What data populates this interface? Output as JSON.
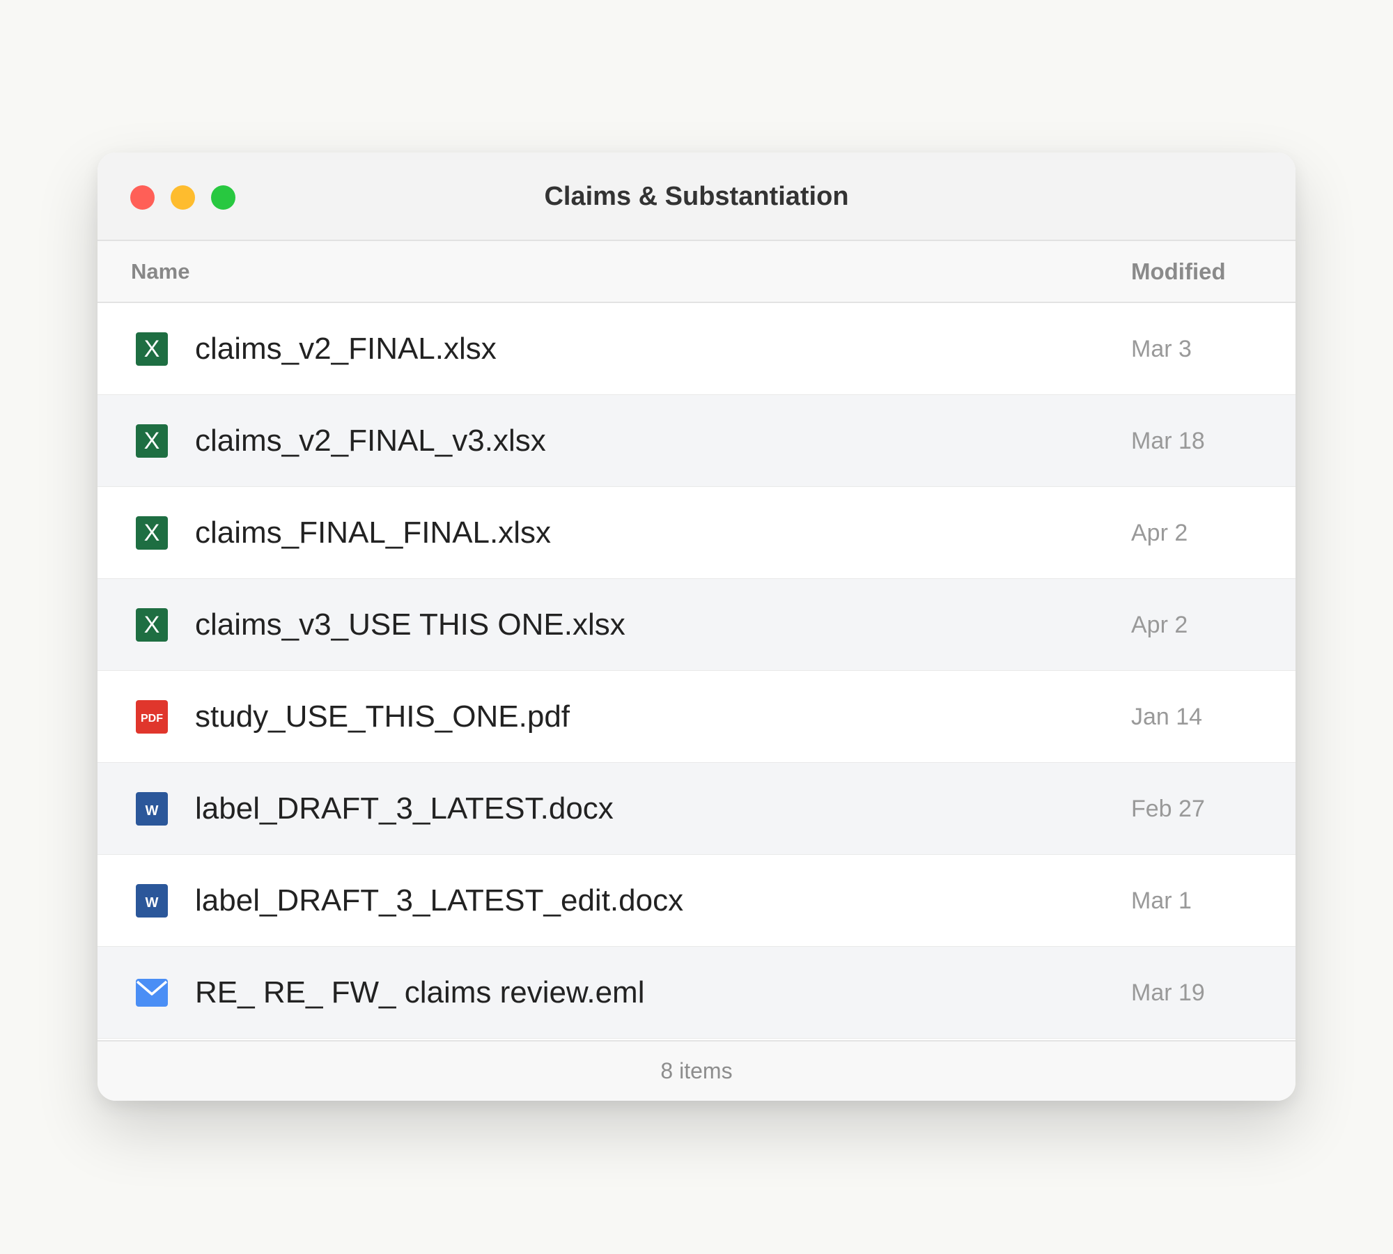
{
  "window": {
    "title": "Claims & Substantiation"
  },
  "columns": {
    "name": "Name",
    "modified": "Modified"
  },
  "files": [
    {
      "name": "claims_v2_FINAL.xlsx",
      "modified": "Mar 3",
      "icon": "excel-icon"
    },
    {
      "name": "claims_v2_FINAL_v3.xlsx",
      "modified": "Mar 18",
      "icon": "excel-icon"
    },
    {
      "name": "claims_FINAL_FINAL.xlsx",
      "modified": "Apr 2",
      "icon": "excel-icon"
    },
    {
      "name": "claims_v3_USE THIS ONE.xlsx",
      "modified": "Apr 2",
      "icon": "excel-icon"
    },
    {
      "name": "study_USE_THIS_ONE.pdf",
      "modified": "Jan 14",
      "icon": "pdf-icon"
    },
    {
      "name": "label_DRAFT_3_LATEST.docx",
      "modified": "Feb 27",
      "icon": "word-icon"
    },
    {
      "name": "label_DRAFT_3_LATEST_edit.docx",
      "modified": "Mar 1",
      "icon": "word-icon"
    },
    {
      "name": "RE_ RE_ FW_ claims review.eml",
      "modified": "Mar 19",
      "icon": "mail-icon"
    }
  ],
  "footer": {
    "count": "8 items"
  },
  "icon_glyphs": {
    "excel": "X",
    "pdf": "PDF",
    "word": "W"
  },
  "colors": {
    "excel": "#1e6e42",
    "pdf": "#e0362c",
    "word": "#2b579a",
    "mail": "#4a8ef5",
    "close": "#ff5f57",
    "minimize": "#febc2e",
    "zoom": "#28c840"
  }
}
